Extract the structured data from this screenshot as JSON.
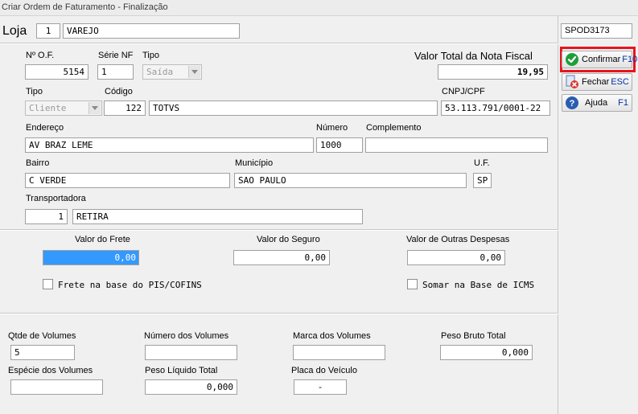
{
  "window": {
    "title": "Criar Ordem de Faturamento - Finalização"
  },
  "loja": {
    "label": "Loja",
    "code": "1",
    "name": "VAREJO"
  },
  "header": {
    "of_label": "Nº O.F.",
    "of_value": "5154",
    "serie_label": "Série NF",
    "serie_value": "1",
    "tipo_label": "Tipo",
    "tipo_value": "Saída",
    "valor_total_label": "Valor Total da Nota Fiscal",
    "valor_total_value": "19,95"
  },
  "cliente": {
    "tipo_label": "Tipo",
    "tipo_value": "Cliente",
    "codigo_label": "Código",
    "codigo_value": "122",
    "nome_value": "TOTVS",
    "cnpj_label": "CNPJ/CPF",
    "cnpj_value": "53.113.791/0001-22"
  },
  "endereco": {
    "endereco_label": "Endereço",
    "endereco_value": "AV BRAZ LEME",
    "numero_label": "Número",
    "numero_value": "1000",
    "complemento_label": "Complemento",
    "complemento_value": "",
    "bairro_label": "Bairro",
    "bairro_value": "C VERDE",
    "municipio_label": "Município",
    "municipio_value": "SAO PAULO",
    "uf_label": "U.F.",
    "uf_value": "SP"
  },
  "transportadora": {
    "label": "Transportadora",
    "code": "1",
    "name": "RETIRA"
  },
  "valores": {
    "frete_label": "Valor do Frete",
    "frete_value": "0,00",
    "seguro_label": "Valor do Seguro",
    "seguro_value": "0,00",
    "outras_label": "Valor de Outras Despesas",
    "outras_value": "0,00",
    "frete_pis_label": "Frete na base do PIS/COFINS",
    "somar_icms_label": "Somar na Base de ICMS"
  },
  "volumes": {
    "qtde_label": "Qtde de Volumes",
    "qtde_value": "5",
    "numero_label": "Número dos Volumes",
    "numero_value": "",
    "marca_label": "Marca dos Volumes",
    "marca_value": "",
    "peso_bruto_label": "Peso Bruto Total",
    "peso_bruto_value": "0,000",
    "especie_label": "Espécie dos Volumes",
    "especie_value": "",
    "peso_liquido_label": "Peso Líquido Total",
    "peso_liquido_value": "0,000",
    "placa_label": "Placa do Veículo",
    "placa_value": "-"
  },
  "sidebar": {
    "code": "SPOD3173",
    "confirmar_label": "Confirmar",
    "confirmar_key": "F10",
    "fechar_label": "Fechar",
    "fechar_key": "ESC",
    "ajuda_label": "Ajuda",
    "ajuda_key": "F1"
  },
  "colors": {
    "highlight": "#3399ff",
    "red_box": "#e8141c",
    "confirm_icon": "#1e9e3a",
    "help_icon": "#2a5db0",
    "close_icon": "#d9342b"
  }
}
